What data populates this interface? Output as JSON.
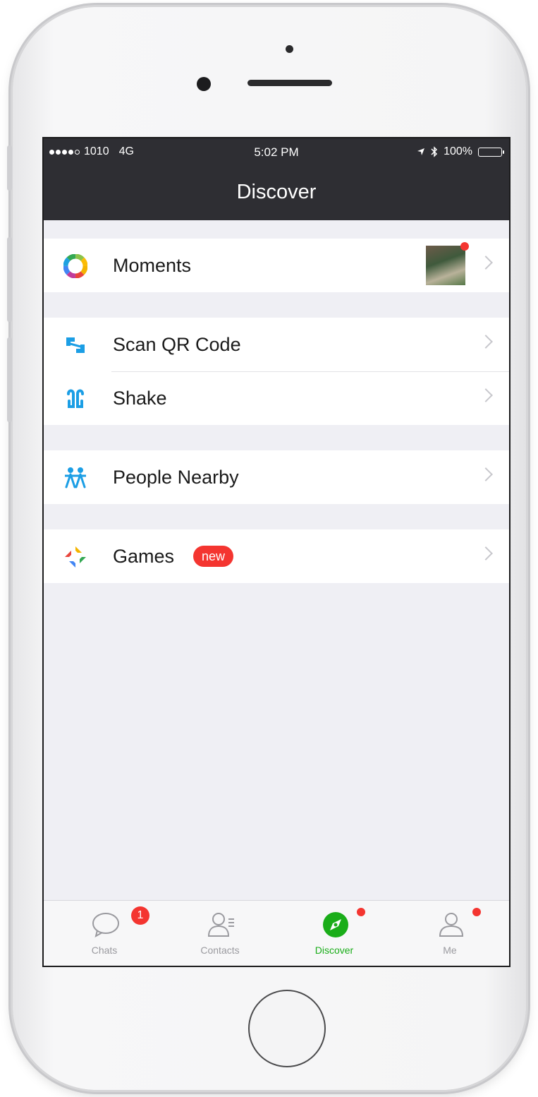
{
  "status_bar": {
    "carrier": "1010",
    "network": "4G",
    "time": "5:02 PM",
    "battery": "100%"
  },
  "navbar": {
    "title": "Discover"
  },
  "menu": {
    "moments": {
      "label": "Moments",
      "icon": "moments-aperture-icon"
    },
    "scan_qr": {
      "label": "Scan QR Code",
      "icon": "scan-qr-icon"
    },
    "shake": {
      "label": "Shake",
      "icon": "shake-icon"
    },
    "people_nearby": {
      "label": "People Nearby",
      "icon": "people-nearby-icon"
    },
    "games": {
      "label": "Games",
      "icon": "games-icon",
      "badge": "new"
    }
  },
  "tabbar": {
    "chats": {
      "label": "Chats",
      "badge": "1"
    },
    "contacts": {
      "label": "Contacts"
    },
    "discover": {
      "label": "Discover"
    },
    "me": {
      "label": "Me"
    }
  },
  "colors": {
    "accent_green": "#1aad19",
    "badge_red": "#f43530",
    "navbar_bg": "#2e2e33",
    "list_bg": "#efeff4"
  }
}
